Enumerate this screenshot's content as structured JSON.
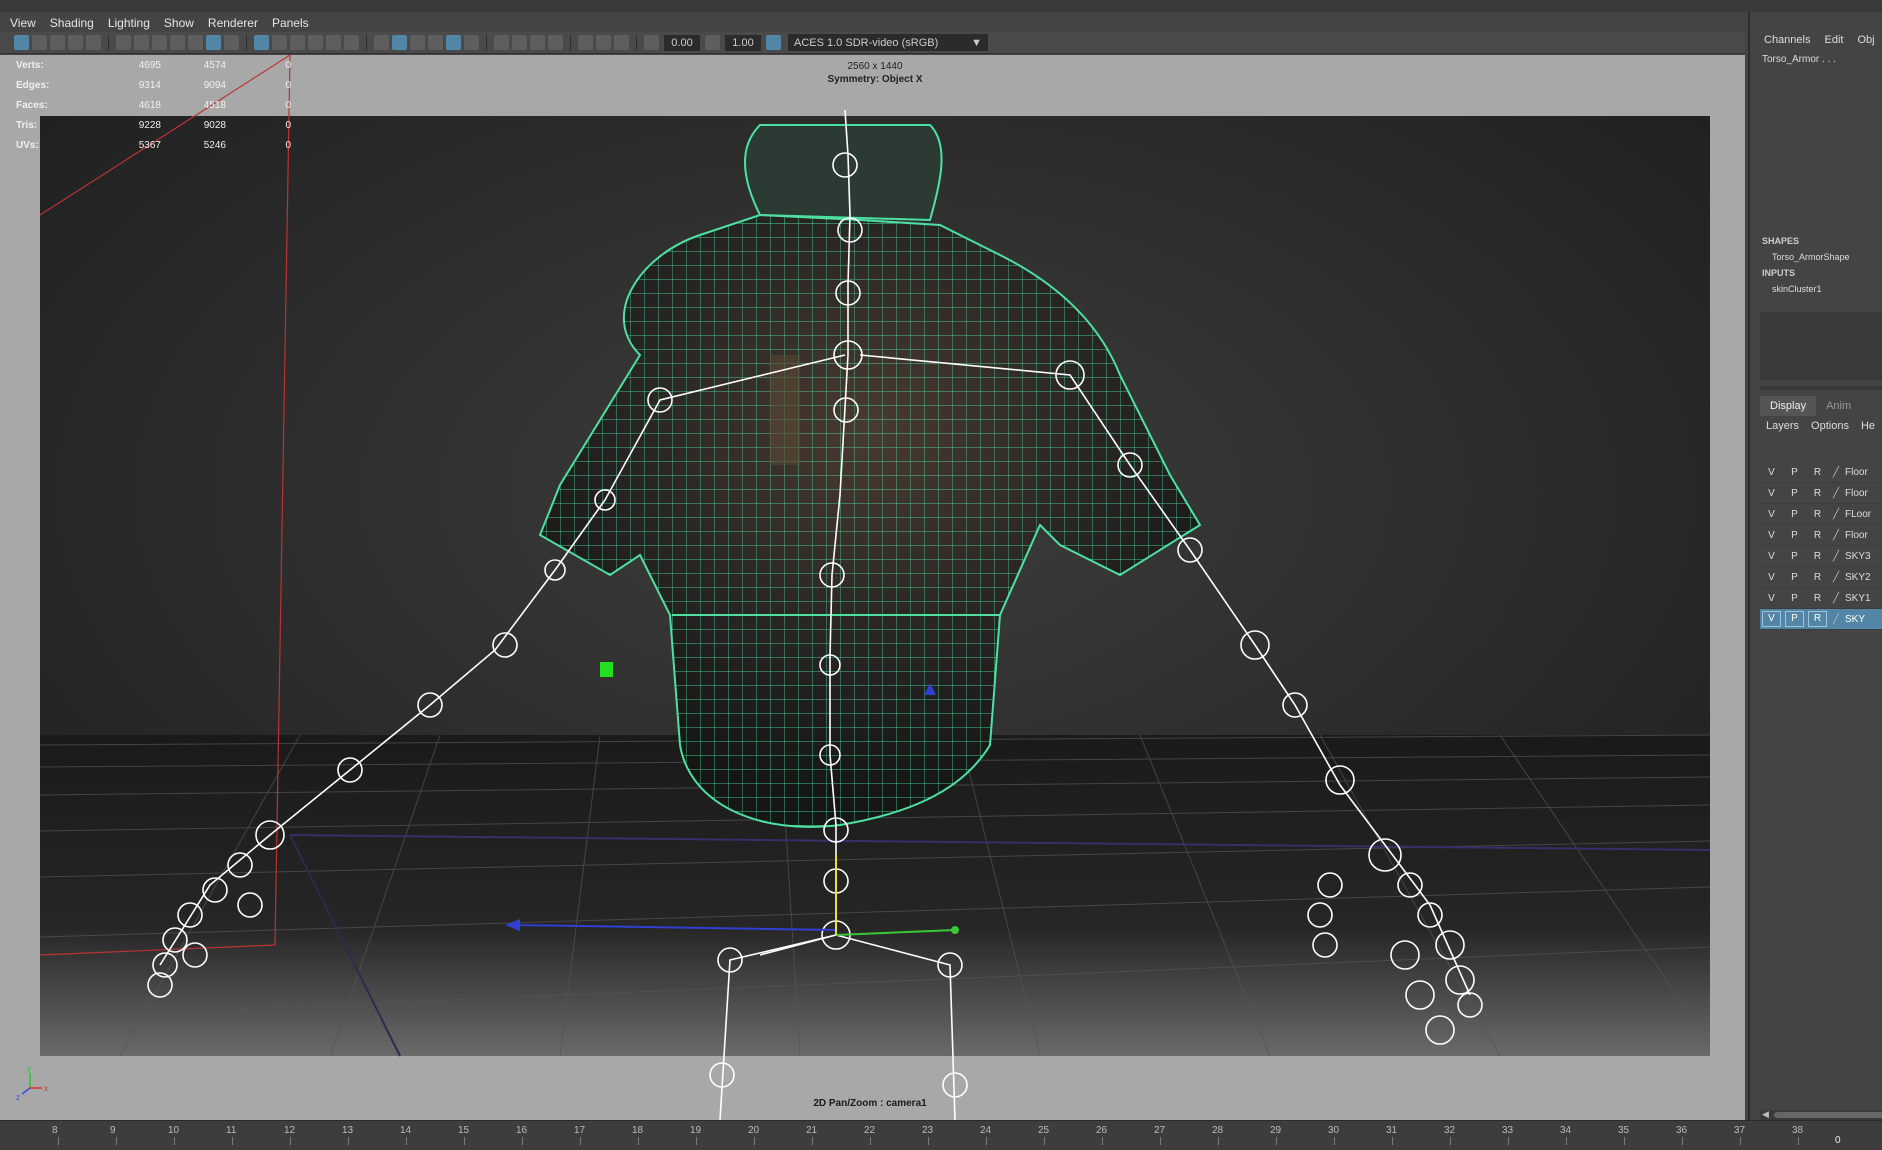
{
  "menu": [
    "View",
    "Shading",
    "Lighting",
    "Show",
    "Renderer",
    "Panels"
  ],
  "toolbar": {
    "exposure": "0.00",
    "gamma": "1.00",
    "color_space": "ACES 1.0 SDR-video (sRGB)"
  },
  "hud": {
    "stats": [
      {
        "label": "Verts:",
        "v1": "4695",
        "v2": "4574",
        "v3": "0"
      },
      {
        "label": "Edges:",
        "v1": "9314",
        "v2": "9094",
        "v3": "0"
      },
      {
        "label": "Faces:",
        "v1": "4618",
        "v2": "4518",
        "v3": "0"
      },
      {
        "label": "Tris:",
        "v1": "9228",
        "v2": "9028",
        "v3": "0"
      },
      {
        "label": "UVs:",
        "v1": "5367",
        "v2": "5246",
        "v3": "0"
      }
    ],
    "resolution": "2560 x 1440",
    "symmetry": "Symmetry: Object X",
    "camera": "2D Pan/Zoom : camera1",
    "axis_x": "x",
    "axis_y": "y",
    "axis_z": "z"
  },
  "timeline": {
    "frames": [
      "8",
      "9",
      "10",
      "11",
      "12",
      "13",
      "14",
      "15",
      "16",
      "17",
      "18",
      "19",
      "20",
      "21",
      "22",
      "23",
      "24",
      "25",
      "26",
      "27",
      "28",
      "29",
      "30",
      "31",
      "32",
      "33",
      "34",
      "35",
      "36",
      "37",
      "38"
    ],
    "current": "0"
  },
  "channel_box": {
    "tabs": [
      "Channels",
      "Edit",
      "Obj"
    ],
    "object_name": "Torso_Armor . . .",
    "shapes_header": "SHAPES",
    "shape_name": "Torso_ArmorShape",
    "inputs_header": "INPUTS",
    "input_name": "skinCluster1"
  },
  "layer_editor": {
    "tabs": [
      "Display",
      "Anim"
    ],
    "menu": [
      "Layers",
      "Options",
      "He"
    ],
    "layers": [
      {
        "v": "V",
        "p": "P",
        "r": "R",
        "name": "Floor"
      },
      {
        "v": "V",
        "p": "P",
        "r": "R",
        "name": "Floor"
      },
      {
        "v": "V",
        "p": "P",
        "r": "R",
        "name": "FLoor"
      },
      {
        "v": "V",
        "p": "P",
        "r": "R",
        "name": "Floor"
      },
      {
        "v": "V",
        "p": "P",
        "r": "R",
        "name": "SKY3"
      },
      {
        "v": "V",
        "p": "P",
        "r": "R",
        "name": "SKY2"
      },
      {
        "v": "V",
        "p": "P",
        "r": "R",
        "name": "SKY1"
      },
      {
        "v": "V",
        "p": "P",
        "r": "R",
        "name": "SKY",
        "selected": true
      }
    ]
  },
  "colors": {
    "wire": "#4de0a0",
    "ui_bg": "#444444",
    "accent": "#5285a6",
    "viewport_bg": "#a8a8a8"
  }
}
